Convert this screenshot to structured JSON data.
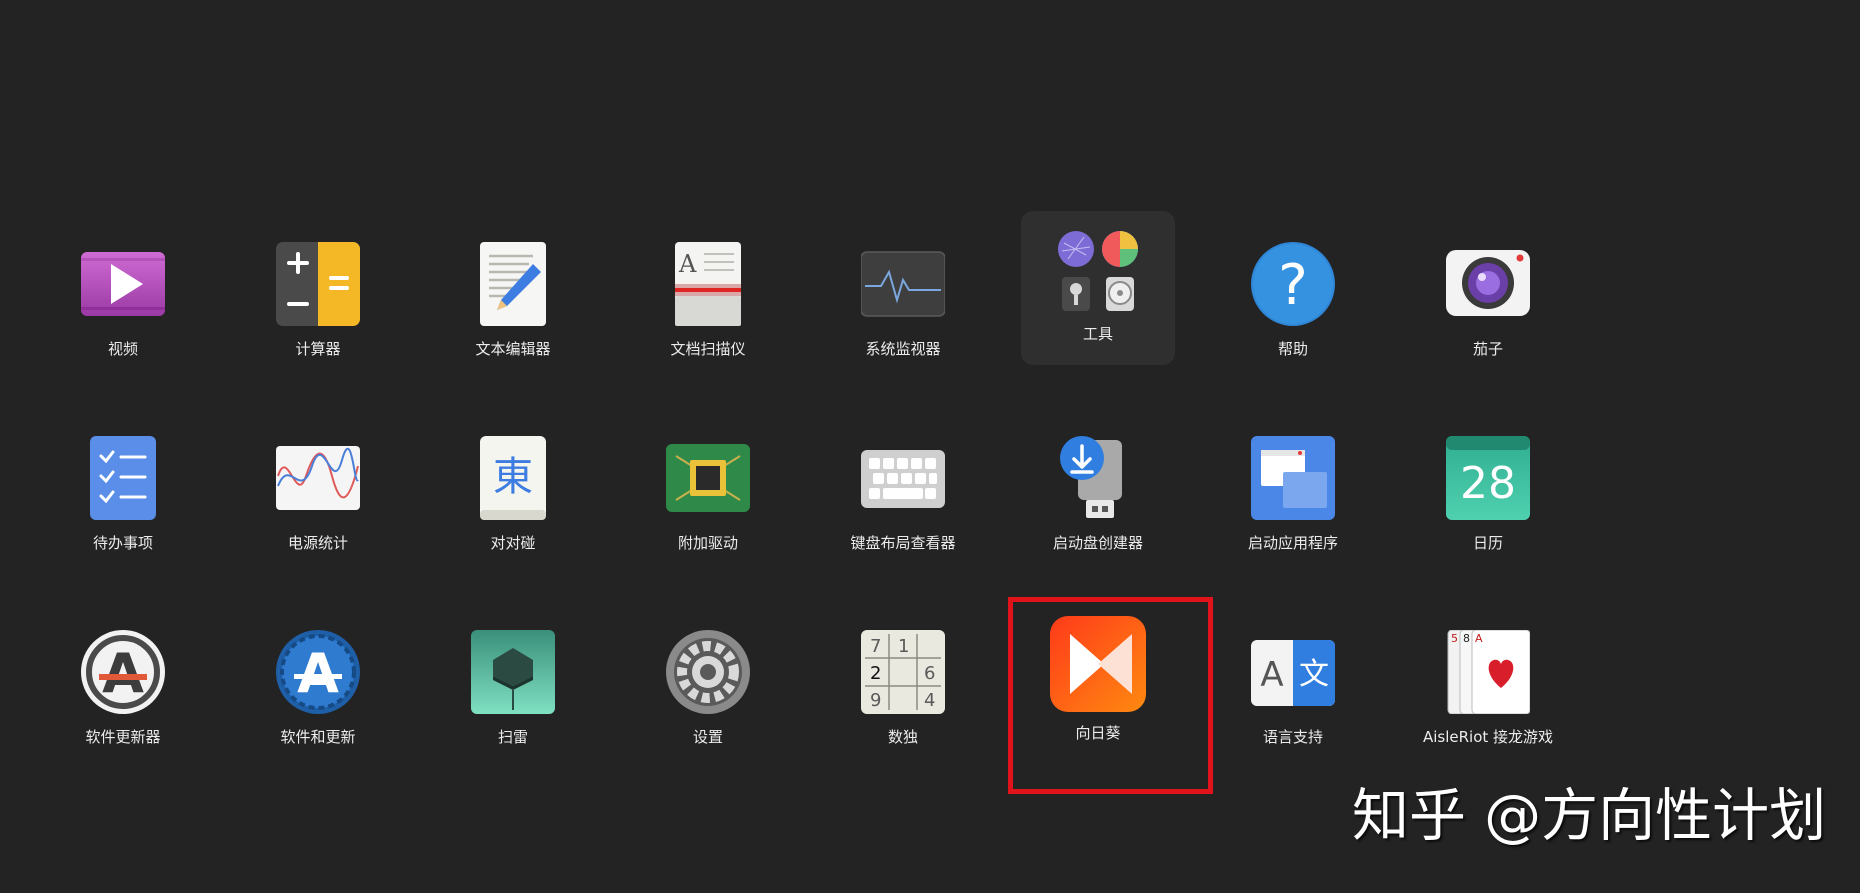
{
  "apps": [
    {
      "label": "视频",
      "icon": "video-player-icon"
    },
    {
      "label": "计算器",
      "icon": "calculator-icon"
    },
    {
      "label": "文本编辑器",
      "icon": "text-editor-icon"
    },
    {
      "label": "文档扫描仪",
      "icon": "document-scanner-icon"
    },
    {
      "label": "系统监视器",
      "icon": "system-monitor-icon"
    },
    {
      "label": "工具",
      "icon": "folder-icon"
    },
    {
      "label": "帮助",
      "icon": "help-icon"
    },
    {
      "label": "茄子",
      "icon": "camera-icon"
    },
    {
      "label": "待办事项",
      "icon": "todo-checklist-icon"
    },
    {
      "label": "电源统计",
      "icon": "power-statistics-icon"
    },
    {
      "label": "对对碰",
      "icon": "mahjongg-tile-icon"
    },
    {
      "label": "附加驱动",
      "icon": "chip-icon"
    },
    {
      "label": "键盘布局查看器",
      "icon": "keyboard-icon"
    },
    {
      "label": "启动盘创建器",
      "icon": "usb-download-icon"
    },
    {
      "label": "启动应用程序",
      "icon": "startup-windows-icon"
    },
    {
      "label": "日历",
      "icon": "calendar-icon",
      "text": "28"
    },
    {
      "label": "软件更新器",
      "icon": "software-updater-icon",
      "glyph": "A"
    },
    {
      "label": "软件和更新",
      "icon": "software-properties-icon",
      "glyph": "A"
    },
    {
      "label": "扫雷",
      "icon": "mine-icon"
    },
    {
      "label": "设置",
      "icon": "gear-icon"
    },
    {
      "label": "数独",
      "icon": "sudoku-icon",
      "digits": [
        "7",
        "1",
        "2",
        "6",
        "9",
        "4"
      ]
    },
    {
      "label": "向日葵",
      "icon": "sunlogin-icon"
    },
    {
      "label": "语言支持",
      "icon": "language-icon",
      "glyphs": [
        "A",
        "文"
      ]
    },
    {
      "label": "AisleRiot 接龙游戏",
      "icon": "playing-cards-icon",
      "ranks": [
        "5",
        "8",
        "A"
      ]
    }
  ],
  "highlighted_app": "向日葵",
  "highlight_color": "#e0131b",
  "watermark": "知乎 @方向性计划"
}
